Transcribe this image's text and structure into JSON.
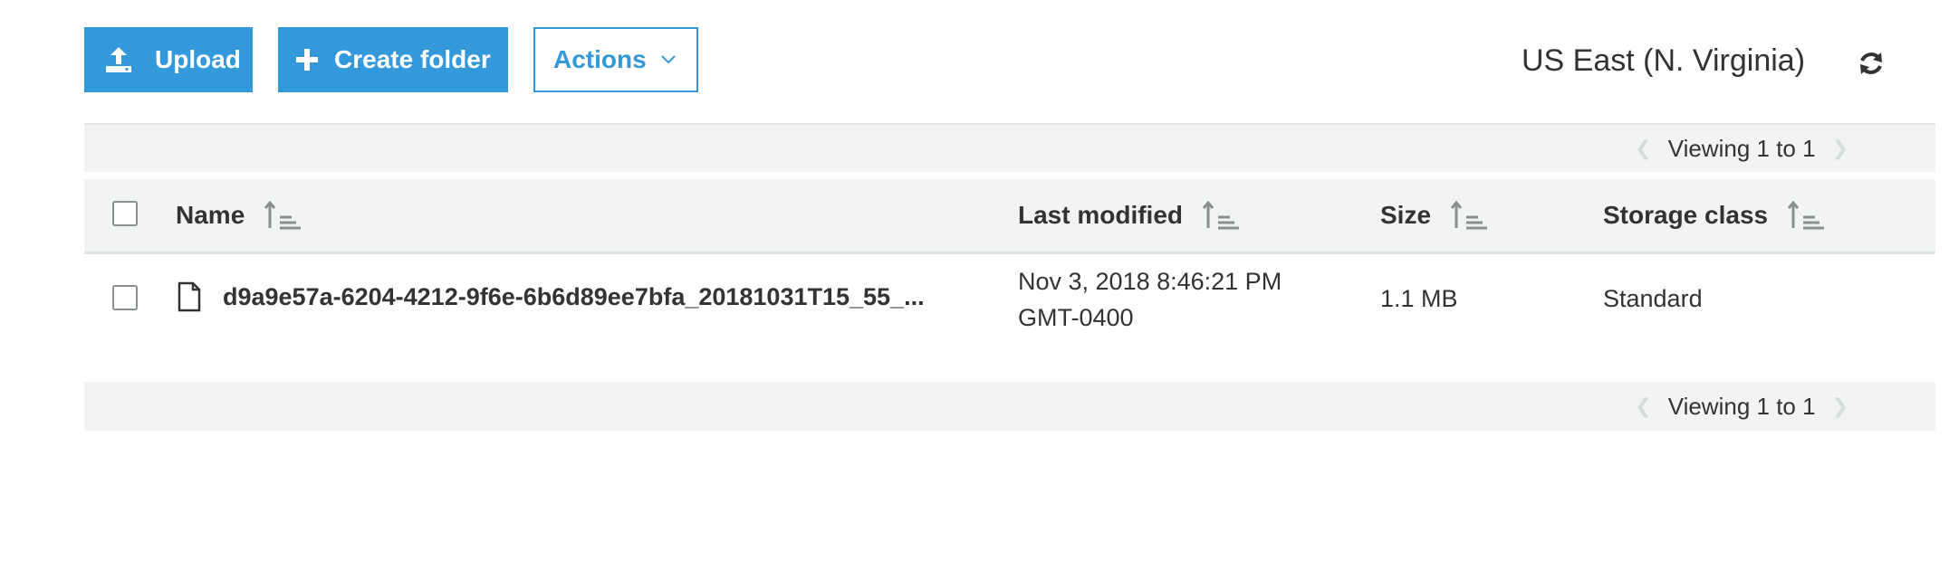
{
  "toolbar": {
    "upload_label": "Upload",
    "create_folder_label": "Create folder",
    "actions_label": "Actions",
    "accent_color": "#3399db"
  },
  "region": {
    "label": "US East (N. Virginia)"
  },
  "pagination": {
    "top_text": "Viewing 1 to 1",
    "bottom_text": "Viewing 1 to 1"
  },
  "table": {
    "columns": [
      {
        "label": "Name"
      },
      {
        "label": "Last modified"
      },
      {
        "label": "Size"
      },
      {
        "label": "Storage class"
      }
    ],
    "rows": [
      {
        "name": "d9a9e57a-6204-4212-9f6e-6b6d89ee7bfa_20181031T15_55_...",
        "modified_line1": "Nov 3, 2018 8:46:21 PM",
        "modified_line2": "GMT-0400",
        "size": "1.1 MB",
        "storage_class": "Standard"
      }
    ]
  },
  "icons": {
    "upload": "upload-icon",
    "create_folder": "plus-icon",
    "actions_dropdown": "chevron-down-icon",
    "refresh": "refresh-icon",
    "sort": "sort-icon",
    "file": "file-icon",
    "pager_prev": "chevron-left-icon",
    "pager_next": "chevron-right-icon"
  }
}
